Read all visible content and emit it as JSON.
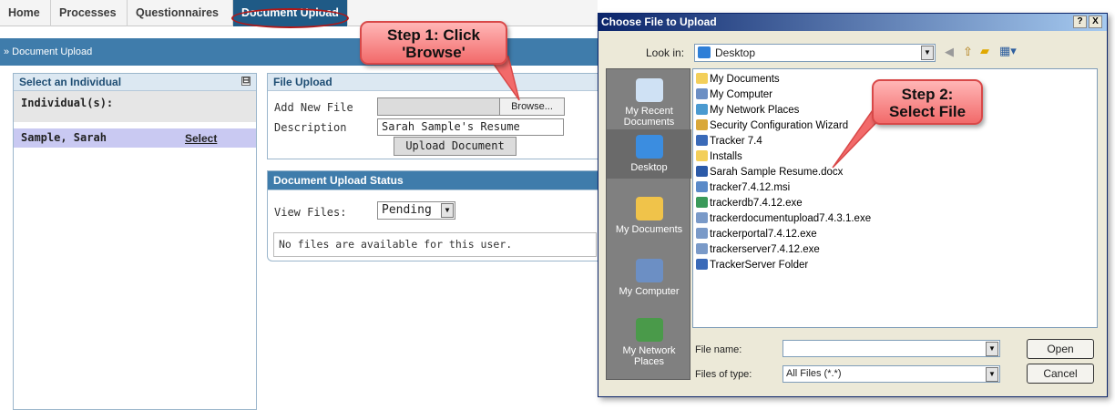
{
  "tabs": [
    {
      "label": "Home"
    },
    {
      "label": "Processes"
    },
    {
      "label": "Questionnaires"
    },
    {
      "label": "Document Upload",
      "active": true
    }
  ],
  "breadcrumb": "» Document Upload",
  "left_panel": {
    "title": "Select an Individual",
    "collapse_glyph": "⊟",
    "header": "Individual(s):",
    "row": {
      "name": "Sample, Sarah",
      "action": "Select"
    }
  },
  "file_upload": {
    "title": "File Upload",
    "add_label": "Add New File",
    "file_value": "",
    "browse_label": "Browse...",
    "description_label": "Description",
    "description_value": "Sarah Sample's Resume",
    "upload_button": "Upload Document"
  },
  "status_panel": {
    "title": "Document Upload Status",
    "view_label": "View Files:",
    "view_value": "Pending",
    "empty_message": "No files are available for this user."
  },
  "callouts": {
    "step1_line1": "Step 1: Click",
    "step1_line2": "'Browse'",
    "step2_line1": "Step 2:",
    "step2_line2": "Select File"
  },
  "dialog": {
    "title": "Choose File to Upload",
    "help_button": "?",
    "close_button": "X",
    "look_in_label": "Look in:",
    "look_in_value": "Desktop",
    "places": [
      "My Recent Documents",
      "Desktop",
      "My Documents",
      "My Computer",
      "My Network Places"
    ],
    "files": [
      {
        "name": "My Documents",
        "icon": "folder-icon"
      },
      {
        "name": "My Computer",
        "icon": "computer-icon"
      },
      {
        "name": "My Network Places",
        "icon": "network-icon"
      },
      {
        "name": "Security Configuration Wizard",
        "icon": "shortcut-icon"
      },
      {
        "name": "Tracker 7.4",
        "icon": "shortcut-icon"
      },
      {
        "name": "Installs",
        "icon": "folder-icon"
      },
      {
        "name": "Sarah Sample Resume.docx",
        "icon": "word-doc-icon"
      },
      {
        "name": "tracker7.4.12.msi",
        "icon": "msi-icon"
      },
      {
        "name": "trackerdb7.4.12.exe",
        "icon": "exe-icon"
      },
      {
        "name": "trackerdocumentupload7.4.3.1.exe",
        "icon": "exe-icon"
      },
      {
        "name": "trackerportal7.4.12.exe",
        "icon": "exe-icon"
      },
      {
        "name": "trackerserver7.4.12.exe",
        "icon": "exe-icon"
      },
      {
        "name": "TrackerServer Folder",
        "icon": "shortcut-icon"
      }
    ],
    "file_name_label": "File name:",
    "file_name_value": "",
    "file_type_label": "Files of type:",
    "file_type_value": "All Files (*.*)",
    "open_button": "Open",
    "cancel_button": "Cancel"
  },
  "colors": {
    "brand_blue": "#1f5a86",
    "header_blue": "#3f7cab",
    "selected_row": "#c9c9f2",
    "callout_red": "#f26a6a",
    "highlight_oval": "#b01818"
  }
}
